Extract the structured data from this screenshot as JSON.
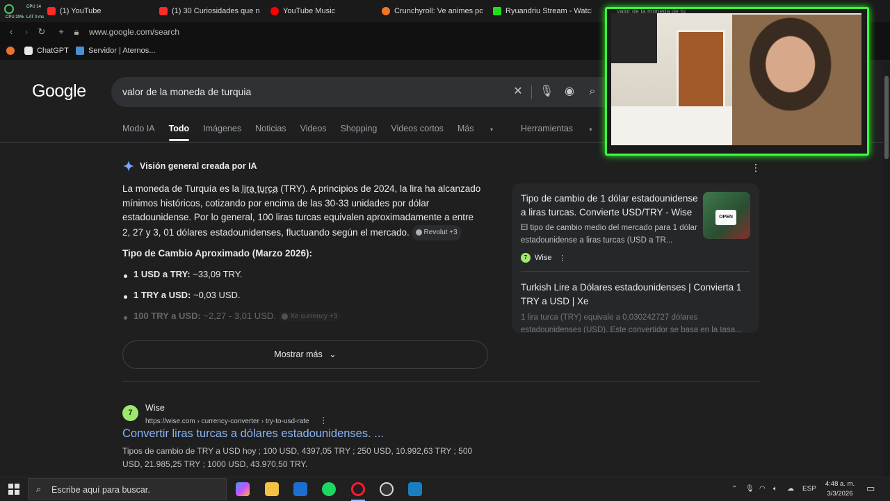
{
  "browser": {
    "tabs": [
      {
        "label": "(1) YouTube",
        "icon": "youtube-icon"
      },
      {
        "label": "(1) 30 Curiosidades que n",
        "icon": "youtube-icon"
      },
      {
        "label": "YouTube Music",
        "icon": "youtube-music-icon"
      },
      {
        "label": "Crunchyroll: Ve animes po",
        "icon": "crunchyroll-icon"
      },
      {
        "label": "Ryuandriu Stream - Watch",
        "icon": "kick-icon"
      }
    ],
    "hud": {
      "l1": "CPU 14",
      "l2": "CPU 20%",
      "l3": "LAT 0 ms"
    },
    "url": "www.google.com/search",
    "bookmarks": [
      {
        "label": "ChatGPT",
        "icon": "chatgpt-icon"
      },
      {
        "label": "Servidor | Aternos...",
        "icon": "aternos-icon"
      }
    ]
  },
  "google": {
    "logo": "Google",
    "query": "valor de la moneda de turquia",
    "tabs": [
      "Modo IA",
      "Todo",
      "Imágenes",
      "Noticias",
      "Videos",
      "Shopping",
      "Videos cortos",
      "Más",
      "Herramientas"
    ],
    "active_tab": "Todo",
    "ai_overview": {
      "heading": "Visión general creada por IA",
      "p_start": "La moneda de Turquía es la ",
      "p_link": "lira turca",
      "p_rest": " (TRY). A principios de 2024, la lira ha alcanzado mínimos históricos, cotizando por encima de las 30-33 unidades por dólar estadounidense. Por lo general, 100 liras turcas equivalen aproximadamente a entre 2, 27 y 3, 01 dólares estadounidenses, fluctuando según el mercado.",
      "chip1": "Revolut +3",
      "subheading": "Tipo de Cambio Aproximado (Marzo 2026):",
      "bullets": [
        {
          "bold": "1 USD a TRY:",
          "text": " ~33,09 TRY."
        },
        {
          "bold": "1 TRY a USD:",
          "text": " ~0,03 USD."
        },
        {
          "bold": "100 TRY a USD:",
          "text": " ~2,27 - 3,01 USD."
        }
      ],
      "chip2": "Xe currency +3",
      "show_more": "Mostrar más"
    },
    "cards": {
      "c1_title": "Tipo de cambio de 1 dólar estadounidense a liras turcas. Convierte USD/TRY - Wise",
      "c1_desc": "El tipo de cambio medio del mercado para 1 dólar estadounidense a liras turcas (USD a TR...",
      "c1_source": "Wise",
      "c1_thumb": "OPEN",
      "c2_title": "Turkish Lire a Dólares estadounidenses | Convierta 1 TRY a USD | Xe",
      "c2_desc": "1 lira turca (TRY) equivale a 0,030242727 dólares estadounidenses (USD). Este convertidor se basa en la tasa..."
    },
    "result": {
      "site": "Wise",
      "url": "https://wise.com › currency-converter › try-to-usd-rate",
      "title": "Convertir liras turcas a dólares estadounidenses. ...",
      "snippet": "Tipos de cambio de TRY a USD hoy ; 100 USD, 4397,05 TRY ; 250 USD, 10.992,63 TRY ; 500 USD, 21.985,25 TRY ; 1000 USD, 43.970,50 TRY."
    }
  },
  "webcam": {
    "overlay_text": "valor de la moneda de tu"
  },
  "taskbar": {
    "search_placeholder": "Escribe aquí para buscar.",
    "lang": "ESP",
    "time": "4:48 a. m.",
    "date": "3/3/2026"
  },
  "colors": {
    "accent_link": "#8ab4f8",
    "webcam_border": "#3cff3c",
    "background": "#1f1f1f"
  }
}
